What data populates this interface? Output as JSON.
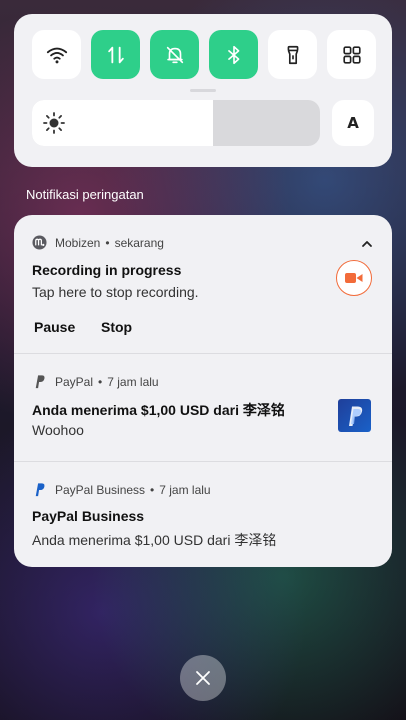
{
  "quick_settings": {
    "tiles": [
      {
        "icon": "wifi-icon",
        "active": false
      },
      {
        "icon": "mobile-data-icon",
        "active": true
      },
      {
        "icon": "silent-bell-icon",
        "active": true
      },
      {
        "icon": "bluetooth-icon",
        "active": true
      },
      {
        "icon": "flashlight-icon",
        "active": false
      },
      {
        "icon": "grid-menu-icon",
        "active": false
      }
    ],
    "brightness_level": 0.63,
    "auto_brightness_label": "A",
    "accent_color": "#2ecf8a"
  },
  "section_label": "Notifikasi peringatan",
  "notifications": [
    {
      "app": "Mobizen",
      "time": "sekarang",
      "title": "Recording in progress",
      "body": "Tap here to stop recording.",
      "actions": [
        "Pause",
        "Stop"
      ],
      "icon": "mobizen-icon",
      "accessory_icon": "video-camera-icon"
    },
    {
      "app": "PayPal",
      "time": "7 jam lalu",
      "title": "Anda menerima $1,00 USD dari 李泽铭",
      "body": "Woohoo",
      "icon": "paypal-icon"
    },
    {
      "app": "PayPal Business",
      "time": "7 jam lalu",
      "title": "PayPal Business",
      "body": "Anda menerima $1,00 USD dari 李泽铭",
      "icon": "paypal-icon"
    }
  ],
  "separator": "•",
  "close_icon": "close-icon",
  "colors": {
    "record_orange": "#f26b3a",
    "paypal_blue": "#1a61c8"
  }
}
